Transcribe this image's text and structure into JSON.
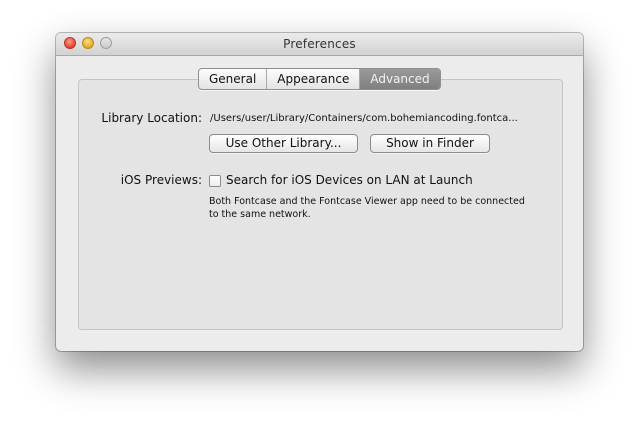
{
  "window": {
    "title": "Preferences"
  },
  "tabs": [
    {
      "label": "General",
      "selected": false
    },
    {
      "label": "Appearance",
      "selected": false
    },
    {
      "label": "Advanced",
      "selected": true
    }
  ],
  "library": {
    "label": "Library Location:",
    "path": "/Users/user/Library/Containers/com.bohemiancoding.fontca...",
    "use_other_label": "Use Other Library...",
    "show_in_finder_label": "Show in Finder"
  },
  "ios": {
    "label": "iOS Previews:",
    "checkbox_label": "Search for iOS Devices on LAN at Launch",
    "checked": false,
    "note": "Both Fontcase and the Fontcase Viewer app need to be connected to the same network."
  },
  "colors": {
    "selected_tab": "#8a8a8a",
    "window_bg": "#ececec"
  }
}
